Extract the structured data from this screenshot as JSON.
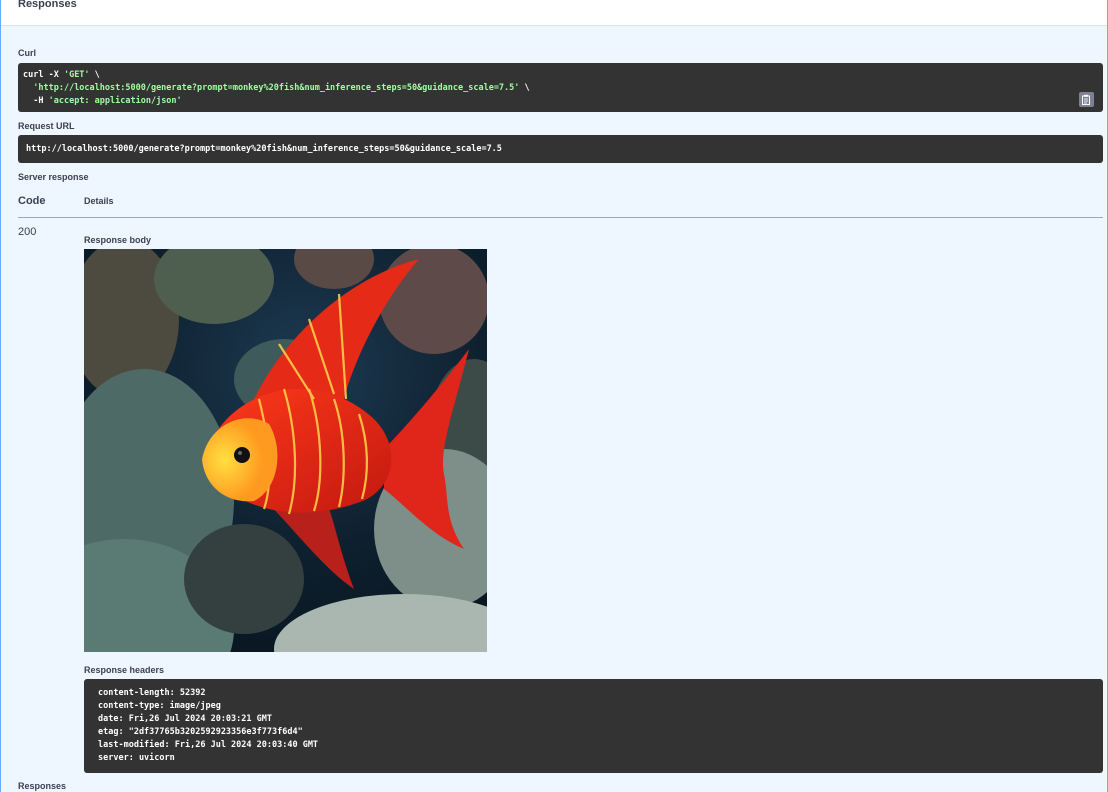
{
  "section": {
    "title": "Responses",
    "footer_title": "Responses"
  },
  "curl": {
    "label": "Curl",
    "line1_prefix": "curl -X ",
    "method": "'GET'",
    "line_cont": " \\",
    "url": "'http://localhost:5000/generate?prompt=monkey%20fish&num_inference_steps=50&guidance_scale=7.5'",
    "header_flag": "-H ",
    "header_value": "'accept: application/json'",
    "copy_icon": "clipboard-icon"
  },
  "request_url": {
    "label": "Request URL",
    "value": "http://localhost:5000/generate?prompt=monkey%20fish&num_inference_steps=50&guidance_scale=7.5"
  },
  "server_response": {
    "label": "Server response",
    "col_code": "Code",
    "col_details": "Details",
    "status_code": "200",
    "body_label": "Response body",
    "headers_label": "Response headers",
    "headers": [
      "content-length: 52392",
      "content-type: image/jpeg",
      "date: Fri,26 Jul 2024 20:03:21 GMT",
      "etag: \"2df37765b3202592923356e3f773f6d4\"",
      "last-modified: Fri,26 Jul 2024 20:03:40 GMT",
      "server: uvicorn"
    ]
  },
  "colors": {
    "panel_bg": "#eef6ff",
    "border": "#61affe",
    "code_bg": "#333333",
    "string": "#a2fca2"
  }
}
